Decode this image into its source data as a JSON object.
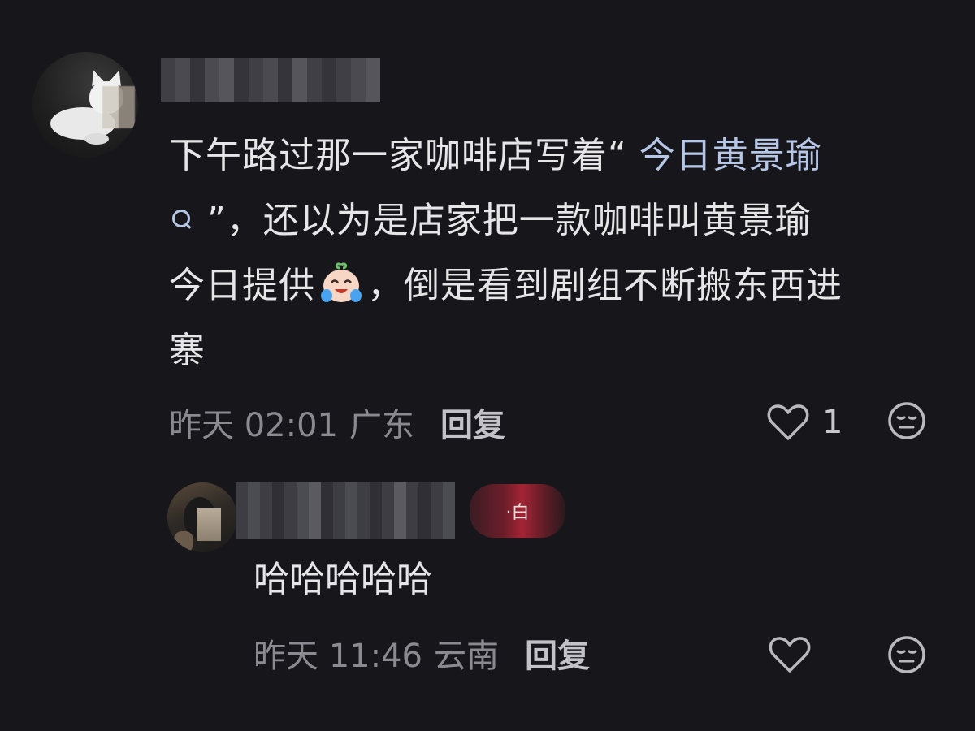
{
  "comment": {
    "text_before_topic": "下午路过那一家咖啡店写着“ ",
    "topic": "今日黄景瑜",
    "text_after_topic_line2": " ”，还以为是店家把一款咖啡叫黄景瑜",
    "text_line3_prefix": "今日提供",
    "text_line3_suffix": "，倒是看到剧组不断搬东西进",
    "text_line4": "寨",
    "emoji": "laugh-cry-emoji",
    "meta": {
      "time": "昨天 02:01",
      "location": "广东",
      "reply_label": "回复",
      "like_count": "1"
    }
  },
  "reply": {
    "badge_text": "·白",
    "text": "哈哈哈哈哈",
    "meta": {
      "time": "昨天 11:46",
      "location": "云南",
      "reply_label": "回复"
    }
  },
  "colors": {
    "background": "#17171b",
    "text": "#e6e6e8",
    "link": "#b6c6e6",
    "meta": "#8a8a90"
  }
}
